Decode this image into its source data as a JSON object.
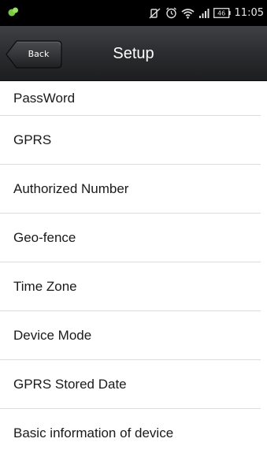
{
  "status_bar": {
    "time": "11:05",
    "icons": [
      "app-notification-icon",
      "mute-icon",
      "alarm-icon",
      "wifi-icon",
      "signal-icon",
      "battery-icon"
    ],
    "battery_level": "46"
  },
  "header": {
    "back_label": "Back",
    "title": "Setup"
  },
  "menu": {
    "items": [
      {
        "label": "PassWord"
      },
      {
        "label": "GPRS"
      },
      {
        "label": "Authorized Number"
      },
      {
        "label": "Geo-fence"
      },
      {
        "label": "Time Zone"
      },
      {
        "label": "Device Mode"
      },
      {
        "label": "GPRS Stored Date"
      },
      {
        "label": "Basic information of device"
      }
    ]
  },
  "colors": {
    "header_top": "#3f4145",
    "header_bottom": "#1d1e20",
    "divider": "#dcdcdc",
    "text": "#1a1a1a",
    "notification_green": "#7ac943"
  }
}
